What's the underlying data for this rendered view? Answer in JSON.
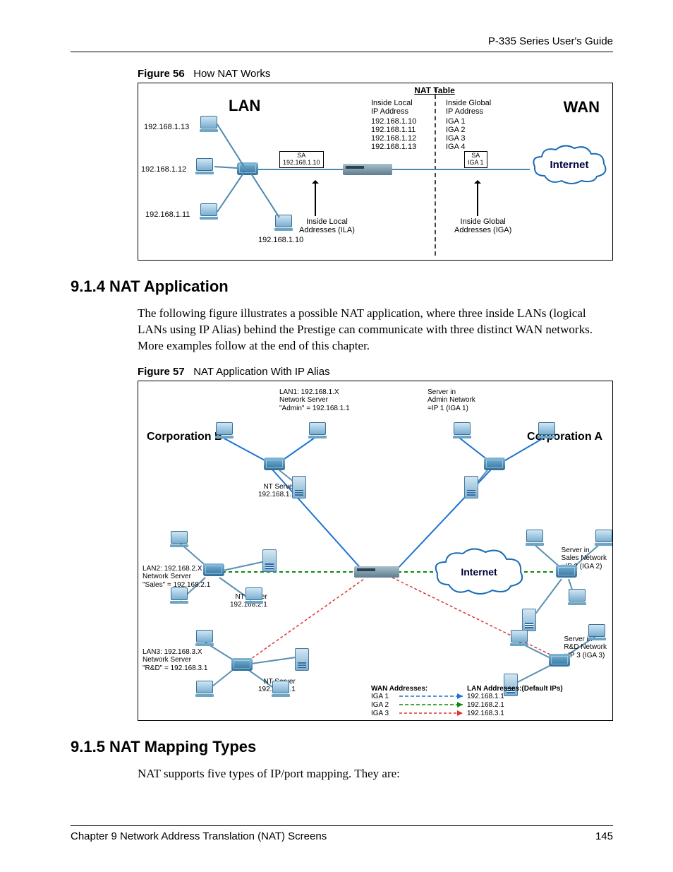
{
  "header": {
    "guide_title": "P-335 Series User's Guide"
  },
  "footer": {
    "chapter": "Chapter 9 Network Address Translation (NAT) Screens",
    "page_number": "145"
  },
  "fig56": {
    "caption_label": "Figure 56",
    "caption_text": "How NAT Works",
    "lan_label": "LAN",
    "wan_label": "WAN",
    "internet_label": "Internet",
    "nat_table_label": "NAT Table",
    "col_local_hdr": "Inside Local\nIP Address",
    "col_global_hdr": "Inside Global\nIP Address",
    "local_ips": [
      "192.168.1.10",
      "192.168.1.11",
      "192.168.1.12",
      "192.168.1.13"
    ],
    "global_ips": [
      "IGA 1",
      "IGA 2",
      "IGA 3",
      "IGA 4"
    ],
    "host13": "192.168.1.13",
    "host12": "192.168.1.12",
    "host11": "192.168.1.11",
    "host10": "192.168.1.10",
    "sa_local_box": "SA\n192.168.1.10",
    "sa_global_box": "SA\nIGA 1",
    "ila_label": "Inside Local\nAddresses (ILA)",
    "iga_label": "Inside Global\nAddresses (IGA)"
  },
  "section914": {
    "heading": "9.1.4  NAT Application",
    "para": "The following figure illustrates a possible NAT application, where three inside LANs (logical LANs using IP Alias) behind the Prestige can communicate with three distinct WAN networks. More examples follow at the end of this chapter."
  },
  "fig57": {
    "caption_label": "Figure 57",
    "caption_text": "NAT Application With IP Alias",
    "corpB": "Corporation B",
    "corpA": "Corporation A",
    "internet_label": "Internet",
    "lan1_text": "LAN1: 192.168.1.X\nNetwork Server\n\"Admin\" = 192.168.1.1",
    "lan2_text": "LAN2: 192.168.2.X\nNetwork Server\n\"Sales\" = 192.168.2.1",
    "lan3_text": "LAN3: 192.168.3.X\nNetwork Server\n\"R&D\" = 192.168.3.1",
    "nt1": "NT Server\n192.168.1.1",
    "nt2": "NT Server\n192.168.2.1",
    "nt3": "NT Server\n192.168.3.1",
    "serverA1": "Server in\nAdmin Network\n=IP 1 (IGA 1)",
    "serverA2": "Server in\nSales Network\n=IP 2 (IGA 2)",
    "serverA3": "Server in\nR&D Network\n=IP 3 (IGA 3)",
    "wan_hdr": "WAN Addresses:",
    "lan_hdr": "LAN Addresses:(Default IPs)",
    "map1w": "IGA 1",
    "map1l": "192.168.1.1",
    "map2w": "IGA 2",
    "map2l": "192.168.2.1",
    "map3w": "IGA 3",
    "map3l": "192.168.3.1"
  },
  "section915": {
    "heading": "9.1.5  NAT Mapping Types",
    "para": "NAT supports five types of IP/port mapping. They are:"
  }
}
